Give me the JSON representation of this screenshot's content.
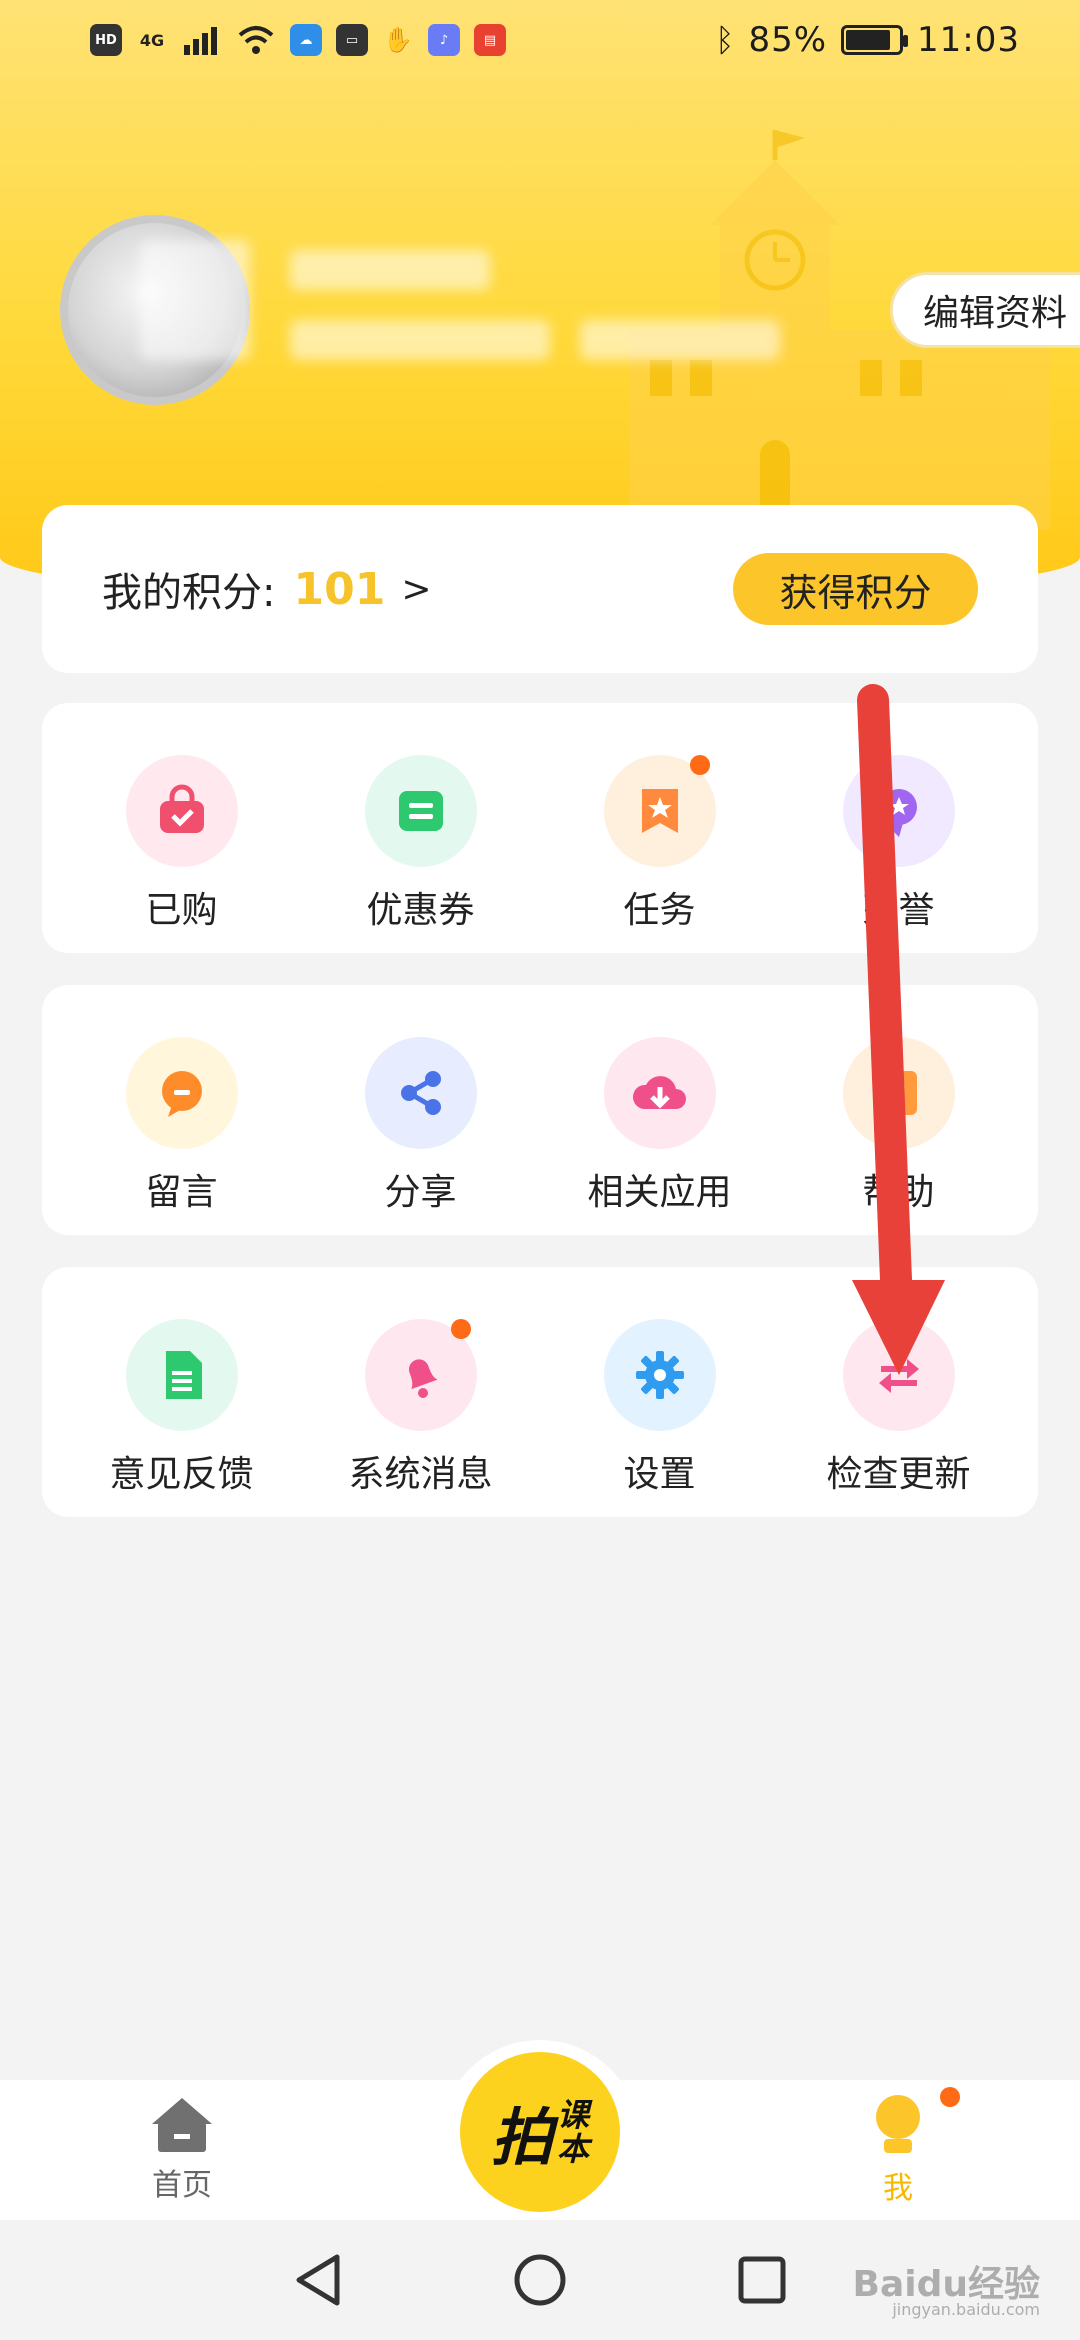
{
  "status_bar": {
    "left_chips": [
      "HD",
      "4G"
    ],
    "bluetooth_icon": "bluetooth-icon",
    "battery_percent": "85%",
    "battery_level": 0.85,
    "time": "11:03"
  },
  "profile": {
    "edit_label": "编辑资料"
  },
  "points": {
    "label": "我的积分:",
    "value": "101",
    "chevron": ">",
    "get_points_label": "获得积分"
  },
  "grid_rows": [
    [
      {
        "label": "已购",
        "icon": "shopping-bag-icon",
        "bg": "#ffe9ee",
        "color": "#f0506e",
        "dot": false
      },
      {
        "label": "优惠券",
        "icon": "coupon-icon",
        "bg": "#e3f8ee",
        "color": "#2ec86e",
        "dot": false
      },
      {
        "label": "任务",
        "icon": "star-bookmark-icon",
        "bg": "#fff0de",
        "color": "#ff8a3d",
        "dot": true
      },
      {
        "label": "荣誉",
        "icon": "medal-icon",
        "bg": "#f1e9ff",
        "color": "#a066f0",
        "dot": false
      }
    ],
    [
      {
        "label": "留言",
        "icon": "message-bubble-icon",
        "bg": "#fff6dc",
        "color": "#ff8c2a",
        "dot": false
      },
      {
        "label": "分享",
        "icon": "share-icon",
        "bg": "#e7edff",
        "color": "#4a73e8",
        "dot": false
      },
      {
        "label": "相关应用",
        "icon": "cloud-download-icon",
        "bg": "#ffe7ef",
        "color": "#f0508a",
        "dot": false
      },
      {
        "label": "帮助",
        "icon": "help-book-icon",
        "bg": "#fff0de",
        "color": "#ff9a3d",
        "dot": false
      }
    ],
    [
      {
        "label": "意见反馈",
        "icon": "document-icon",
        "bg": "#e3f8ee",
        "color": "#2ec86e",
        "dot": false
      },
      {
        "label": "系统消息",
        "icon": "bell-icon",
        "bg": "#ffe7ef",
        "color": "#f0508a",
        "dot": true
      },
      {
        "label": "设置",
        "icon": "gear-icon",
        "bg": "#e3f2ff",
        "color": "#2f9cf0",
        "dot": false
      },
      {
        "label": "检查更新",
        "icon": "refresh-arrows-icon",
        "bg": "#ffe7ef",
        "color": "#f0508a",
        "dot": false
      }
    ]
  ],
  "tabbar": {
    "home_label": "首页",
    "center_main": "拍",
    "center_sub1": "课",
    "center_sub2": "本",
    "me_label": "我"
  },
  "watermark": {
    "text": "Baidu经验",
    "sub": "jingyan.baidu.com"
  },
  "colors": {
    "accent": "#fcc62a",
    "points_value": "#f6c32b",
    "badge_dot": "#ff6a16",
    "annotation_arrow": "#e8413a"
  }
}
